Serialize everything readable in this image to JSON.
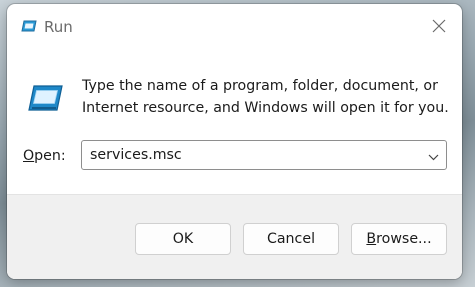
{
  "window": {
    "title": "Run",
    "title_icon": "run-icon",
    "close_icon": "close-icon"
  },
  "body": {
    "icon": "run-icon",
    "message_line1": "Type the name of a program, folder, document, or",
    "message_line2": "Internet resource, and Windows will open it for you."
  },
  "open_field": {
    "label_underlined": "O",
    "label_rest": "pen:",
    "value": "services.msc",
    "dropdown_icon": "chevron-down-icon"
  },
  "buttons": {
    "ok": "OK",
    "cancel": "Cancel",
    "browse_underlined": "B",
    "browse_rest": "rowse..."
  },
  "colors": {
    "accent_icon": "#1e88c8",
    "footer_bg": "#f0f0f0",
    "window_bg": "#ffffff"
  }
}
